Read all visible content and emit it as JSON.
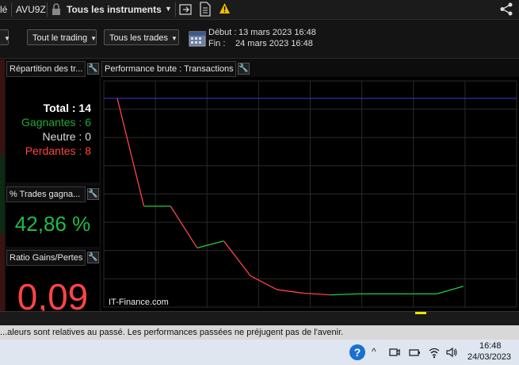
{
  "topbar": {
    "left_fragment": "lé",
    "account": "AVU9Z",
    "instruments": "Tous les instruments",
    "icons": [
      "lock-icon",
      "export-icon",
      "document-icon",
      "warning-icon",
      "share-icon"
    ]
  },
  "filters": {
    "trading": "Tout le trading",
    "trades": "Tous les trades",
    "start_label": "Début :",
    "start_value": "13 mars 2023 16:48",
    "end_label": "Fin :",
    "end_value": "24 mars 2023 16:48"
  },
  "panels": {
    "repartition": {
      "title": "Répartition des tr...",
      "total": "Total : 14",
      "gagnantes": "Gagnantes : 6",
      "neutre": "Neutre : 0",
      "perdantes": "Perdantes : 8"
    },
    "pct_trades": {
      "title": "% Trades gagna...",
      "value": "42,86 %"
    },
    "ratio": {
      "title": "Ratio Gains/Pertes",
      "value": "0,09"
    },
    "performance": {
      "title": "Performance brute : Transactions"
    }
  },
  "colors": {
    "gain": "#22cc44",
    "loss": "#ff4444",
    "baseline": "#3333cc",
    "grid": "#2a2a2a"
  },
  "chart_data": {
    "type": "line",
    "title": "",
    "x": [
      1,
      2,
      3,
      4,
      5,
      6,
      7,
      8,
      9,
      10,
      11,
      12,
      13,
      14
    ],
    "values": [
      10,
      -21,
      -21,
      -33,
      -31,
      -41,
      -45,
      -46,
      -46.5,
      -46.2,
      -46.2,
      -46.2,
      -46.2,
      -44
    ],
    "result": [
      "start",
      "loss",
      "gain",
      "loss",
      "gain",
      "loss",
      "loss",
      "loss",
      "loss",
      "gain",
      "gain",
      "gain",
      "gain",
      "gain"
    ],
    "baseline": 10,
    "grid": true,
    "watermark": "IT-Finance.com"
  },
  "disclaimer": "...aleurs sont relatives au passé. Les performances passées ne préjugent pas de l'avenir.",
  "taskbar": {
    "time": "16:48",
    "date": "24/03/2023"
  }
}
